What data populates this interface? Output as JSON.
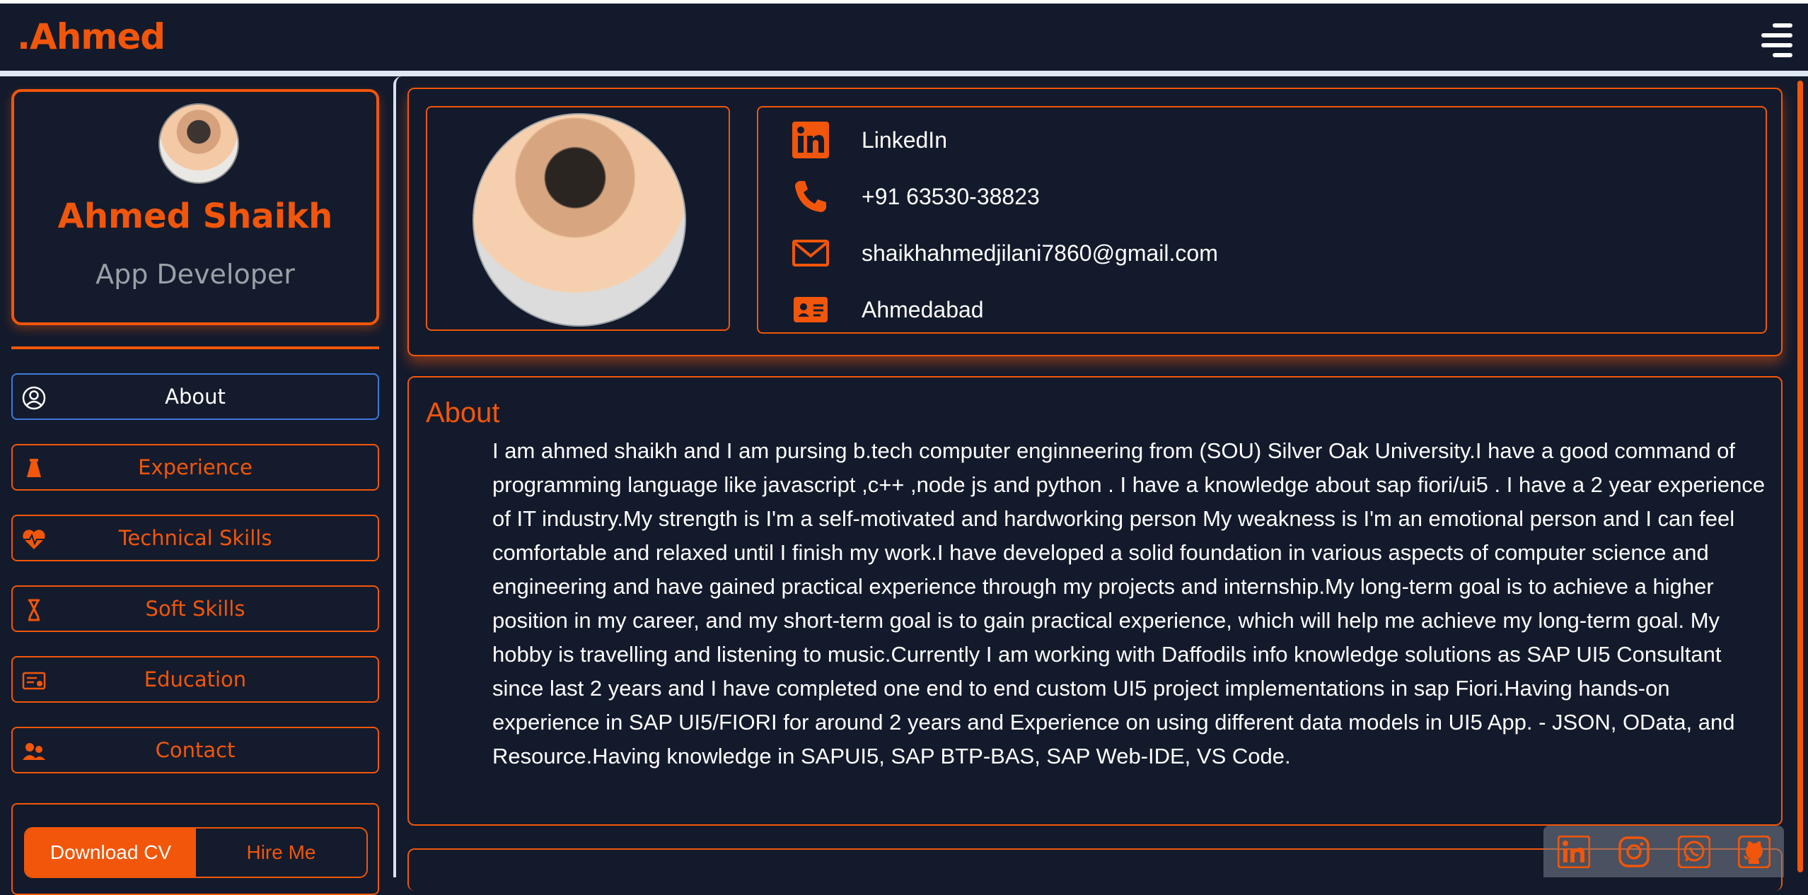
{
  "brand": ".Ahmed",
  "colors": {
    "accent": "#f1560a",
    "bg": "#131a2c",
    "active_border": "#3f79d8"
  },
  "profile": {
    "name": "Ahmed Shaikh",
    "role": "App Developer"
  },
  "nav": {
    "items": [
      {
        "label": "About",
        "icon": "user-circle-icon",
        "active": true
      },
      {
        "label": "Experience",
        "icon": "flask-icon",
        "active": false
      },
      {
        "label": "Technical Skills",
        "icon": "heart-pulse-icon",
        "active": false
      },
      {
        "label": "Soft Skills",
        "icon": "hourglass-icon",
        "active": false
      },
      {
        "label": "Education",
        "icon": "certificate-icon",
        "active": false
      },
      {
        "label": "Contact",
        "icon": "users-icon",
        "active": false
      }
    ]
  },
  "cta": {
    "primary": "Download CV",
    "secondary": "Hire Me"
  },
  "contact": [
    {
      "icon": "linkedin-icon",
      "text": "LinkedIn"
    },
    {
      "icon": "phone-icon",
      "text": "+91 63530-38823"
    },
    {
      "icon": "email-icon",
      "text": "shaikhahmedjilani7860@gmail.com"
    },
    {
      "icon": "id-card-icon",
      "text": "Ahmedabad"
    }
  ],
  "about": {
    "title": "About",
    "text": "I am ahmed shaikh and I am pursing b.tech computer enginneering from (SOU) Silver Oak University.I have a good command of programming language like javascript ,c++ ,node js and python . I have a knowledge about sap fiori/ui5 . I have a 2 year experience of IT industry.My strength is I'm a self-motivated and hardworking person My weakness is I'm an emotional person and I can feel comfortable and relaxed until I finish my work.I have developed a solid foundation in various aspects of computer science and engineering and have gained practical experience through my projects and internship.My long-term goal is to achieve a higher position in my career, and my short-term goal is to gain practical experience, which will help me achieve my long-term goal. My hobby is travelling and listening to music.Currently I am working with Daffodils info knowledge solutions as SAP UI5 Consultant since last 2 years and I have completed one end to end custom UI5 project implementations in sap Fiori.Having hands-on experience in SAP UI5/FIORI for around 2 years and Experience on using different data models in UI5 App. - JSON, OData, and Resource.Having knowledge in SAPUI5, SAP BTP-BAS, SAP Web-IDE, VS Code."
  },
  "social": [
    "linkedin-icon",
    "instagram-icon",
    "whatsapp-icon",
    "github-icon"
  ]
}
